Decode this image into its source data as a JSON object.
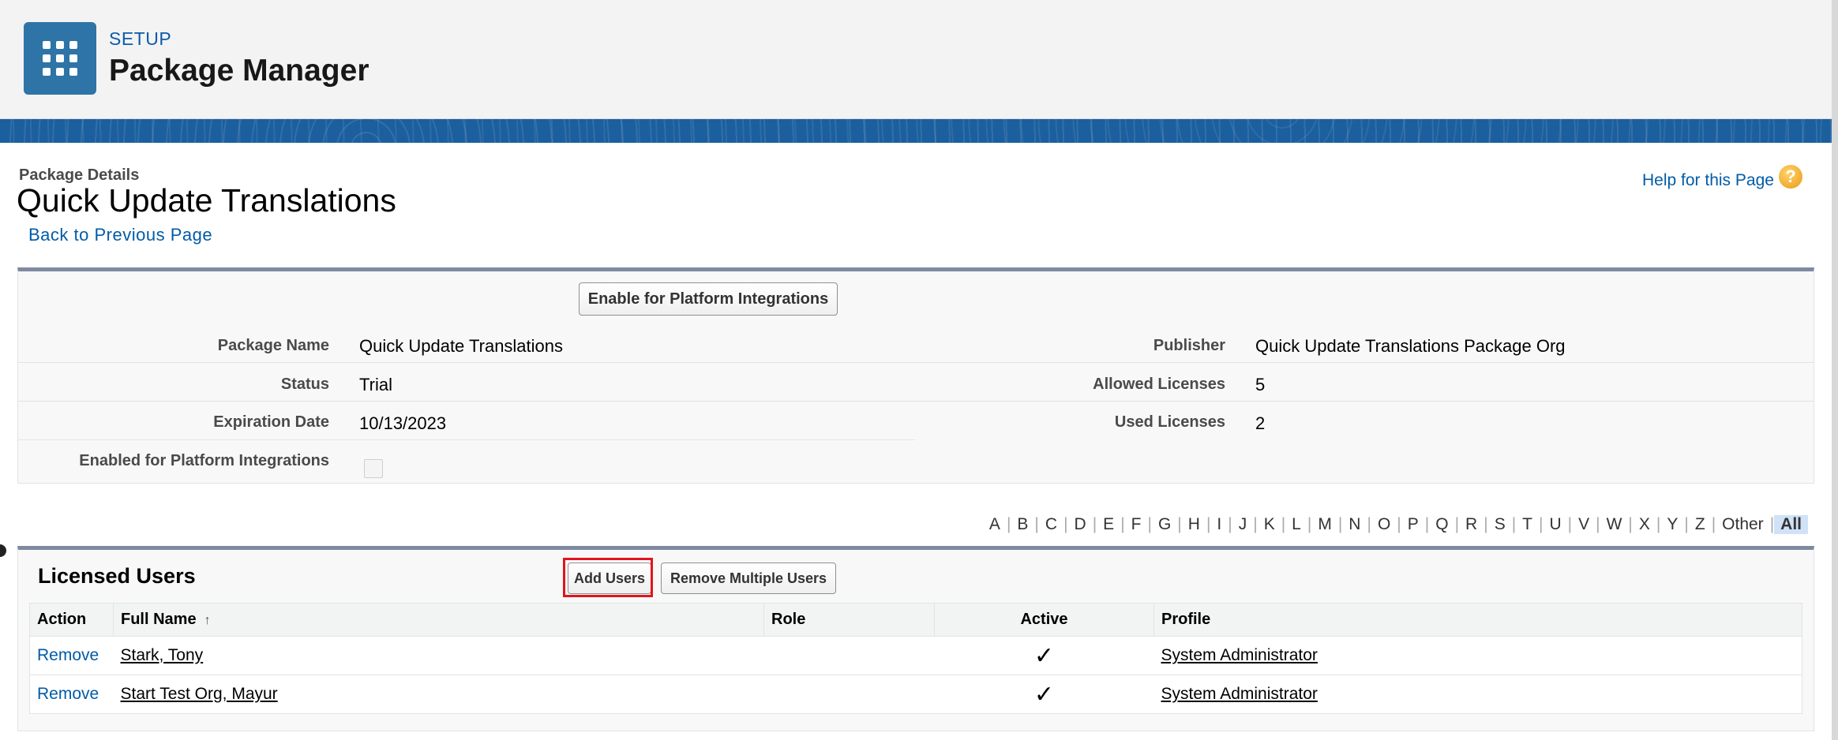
{
  "header": {
    "section": "SETUP",
    "title": "Package Manager"
  },
  "page": {
    "label": "Package Details",
    "title": "Quick Update Translations",
    "back_link": "Back to Previous Page",
    "help_link": "Help for this Page"
  },
  "detail": {
    "enable_button": "Enable for Platform Integrations",
    "fields": {
      "package_name_label": "Package Name",
      "package_name": "Quick Update Translations",
      "status_label": "Status",
      "status": "Trial",
      "expiration_label": "Expiration Date",
      "expiration": "10/13/2023",
      "enabled_platform_label": "Enabled for Platform Integrations",
      "publisher_label": "Publisher",
      "publisher": "Quick Update Translations Package Org",
      "allowed_label": "Allowed Licenses",
      "allowed": "5",
      "used_label": "Used Licenses",
      "used": "2"
    }
  },
  "alphabet": [
    "A",
    "B",
    "C",
    "D",
    "E",
    "F",
    "G",
    "H",
    "I",
    "J",
    "K",
    "L",
    "M",
    "N",
    "O",
    "P",
    "Q",
    "R",
    "S",
    "T",
    "U",
    "V",
    "W",
    "X",
    "Y",
    "Z",
    "Other",
    "All"
  ],
  "licensed_users": {
    "title": "Licensed Users",
    "add_button": "Add Users",
    "remove_multiple_button": "Remove Multiple Users",
    "columns": {
      "action": "Action",
      "full_name": "Full Name",
      "role": "Role",
      "active": "Active",
      "profile": "Profile"
    },
    "rows": [
      {
        "action": "Remove",
        "name": "Stark, Tony",
        "role": "",
        "active": "✓",
        "profile": "System Administrator"
      },
      {
        "action": "Remove",
        "name": "Start Test Org, Mayur",
        "role": "",
        "active": "✓",
        "profile": "System Administrator"
      }
    ]
  },
  "colors": {
    "brand_blue": "#2e74a6",
    "link_blue": "#015ba7",
    "highlight_red": "#e1141c"
  }
}
